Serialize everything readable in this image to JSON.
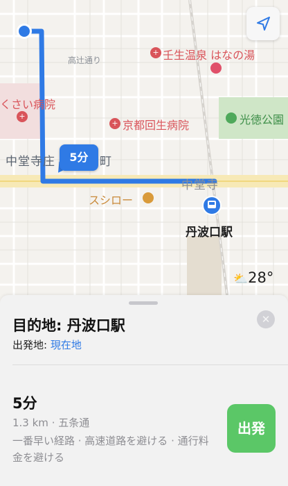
{
  "map": {
    "labels": {
      "takatsuji": "高辻通り",
      "mibu_onsen": "壬生温泉 はなの湯",
      "kusai_hospital": "くさい病院",
      "kyoto_kaisei": "京都回生病院",
      "koutoku_park": "光徳公園",
      "chudoji_area": "中堂寺庄",
      "chudoji_area2": "町",
      "chudoji_road": "中堂寺",
      "sushiro": "スシロー",
      "tamba_station": "丹波口駅"
    },
    "eta_bubble": "5分",
    "weather": {
      "temp": "28°",
      "icon": "partly-cloudy-icon"
    },
    "colors": {
      "route": "#2f7ae5",
      "hospital": "#d9545a",
      "park": "#4fa95b",
      "station": "#2f7ae5"
    }
  },
  "sheet": {
    "destination_title": "目的地: 丹波口駅",
    "origin_label": "出発地: ",
    "origin_value": "現在地",
    "route": {
      "time": "5分",
      "distance_via": "1.3 km · 五条通",
      "description": "一番早い経路 · 高速道路を避ける · 通行料金を避ける"
    },
    "go_button": "出発",
    "close_icon": "✕"
  }
}
